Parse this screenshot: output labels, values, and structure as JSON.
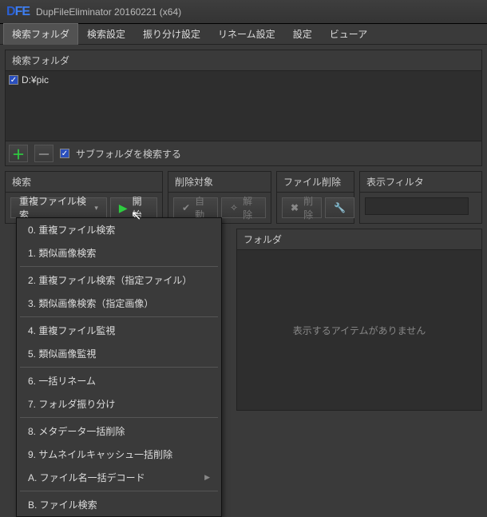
{
  "titlebar": {
    "logo_d": "D",
    "logo_fe": "FE",
    "title": "DupFileEliminator 20160221 (x64)"
  },
  "menubar": {
    "items": [
      {
        "label": "検索フォルダ",
        "active": true
      },
      {
        "label": "検索設定"
      },
      {
        "label": "振り分け設定"
      },
      {
        "label": "リネーム設定"
      },
      {
        "label": "設定"
      },
      {
        "label": "ビューア"
      }
    ]
  },
  "folders": {
    "header": "検索フォルダ",
    "rows": [
      {
        "checked": true,
        "path": "D:¥pic"
      }
    ],
    "subfolder_checked": true,
    "subfolder_label": "サブフォルダを検索する"
  },
  "sections": {
    "search": {
      "title": "検索",
      "dropdown_label": "重複ファイル検索",
      "start_label": "開始"
    },
    "target": {
      "title": "削除対象",
      "auto_label": "自動",
      "unmark_label": "解除"
    },
    "delete": {
      "title": "ファイル削除",
      "delete_label": "削除"
    },
    "filter": {
      "title": "表示フィルタ"
    }
  },
  "context_menu": {
    "items": [
      {
        "label": "0. 重複ファイル検索"
      },
      {
        "label": "1. 類似画像検索"
      },
      {
        "sep": true
      },
      {
        "label": "2. 重複ファイル検索（指定ファイル）"
      },
      {
        "label": "3. 類似画像検索（指定画像）"
      },
      {
        "sep": true
      },
      {
        "label": "4. 重複ファイル監視"
      },
      {
        "label": "5. 類似画像監視"
      },
      {
        "sep": true
      },
      {
        "label": "6. 一括リネーム"
      },
      {
        "label": "7. フォルダ振り分け"
      },
      {
        "sep": true
      },
      {
        "label": "8. メタデータ一括削除"
      },
      {
        "label": "9. サムネイルキャッシュ一括削除"
      },
      {
        "label": "A. ファイル名一括デコード",
        "sub": true
      },
      {
        "sep": true
      },
      {
        "label": "B. ファイル検索"
      }
    ]
  },
  "grid": {
    "column_header": "フォルダ",
    "empty_text": "表示するアイテムがありません"
  }
}
